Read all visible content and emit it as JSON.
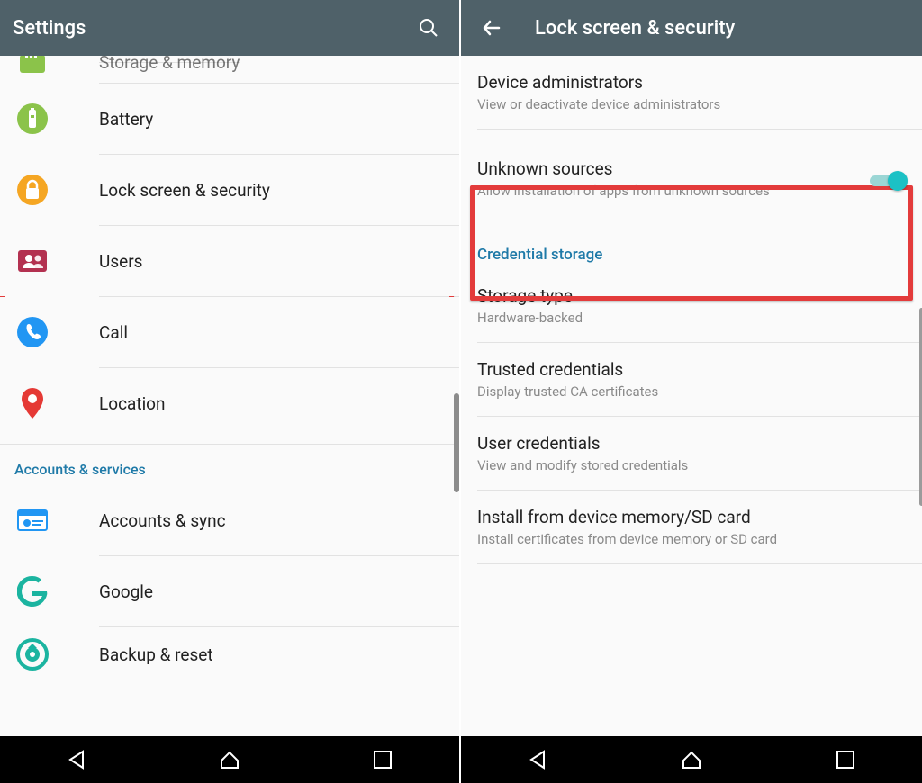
{
  "left": {
    "toolbar": {
      "title": "Settings"
    },
    "items": {
      "storage": "Storage & memory",
      "battery": "Battery",
      "lock": "Lock screen & security",
      "users": "Users",
      "call": "Call",
      "location": "Location"
    },
    "section_accounts": "Accounts & services",
    "accounts_items": {
      "sync": "Accounts & sync",
      "google": "Google",
      "backup": "Backup & reset"
    }
  },
  "right": {
    "toolbar": {
      "title": "Lock screen & security"
    },
    "device_admin": {
      "title": "Device administrators",
      "sub": "View or deactivate device administrators"
    },
    "unknown": {
      "title": "Unknown sources",
      "sub": "Allow installation of apps from unknown sources"
    },
    "cred_header": "Credential storage",
    "storage_type": {
      "title": "Storage type",
      "sub": "Hardware-backed"
    },
    "trusted": {
      "title": "Trusted credentials",
      "sub": "Display trusted CA certificates"
    },
    "usercred": {
      "title": "User credentials",
      "sub": "View and modify stored credentials"
    },
    "install": {
      "title": "Install from device memory/SD card",
      "sub": "Install certificates from device memory or SD card"
    }
  }
}
